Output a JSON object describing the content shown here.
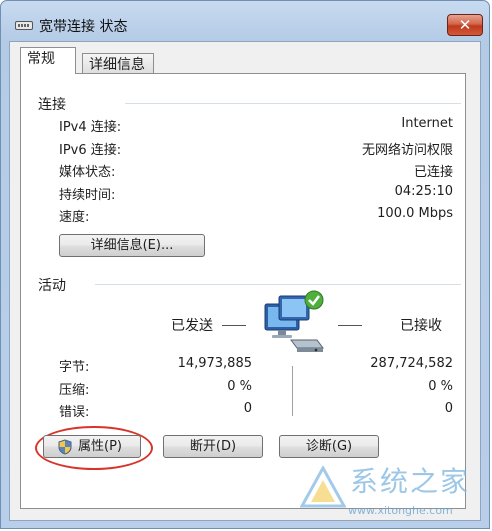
{
  "window": {
    "title": "宽带连接 状态",
    "close_label": "✕"
  },
  "tabs": [
    {
      "label": "常规",
      "active": true
    },
    {
      "label": "详细信息",
      "active": false
    }
  ],
  "connection": {
    "section_label": "连接",
    "rows": [
      {
        "label": "IPv4 连接:",
        "value": "Internet"
      },
      {
        "label": "IPv6 连接:",
        "value": "无网络访问权限"
      },
      {
        "label": "媒体状态:",
        "value": "已连接"
      },
      {
        "label": "持续时间:",
        "value": "04:25:10"
      },
      {
        "label": "速度:",
        "value": "100.0 Mbps"
      }
    ],
    "details_button": "详细信息(E)..."
  },
  "activity": {
    "section_label": "活动",
    "sent_label": "已发送",
    "received_label": "已接收",
    "rows": [
      {
        "label": "字节:",
        "sent": "14,973,885",
        "received": "287,724,582"
      },
      {
        "label": "压缩:",
        "sent": "0 %",
        "received": "0 %"
      },
      {
        "label": "错误:",
        "sent": "0",
        "received": "0"
      }
    ]
  },
  "buttons": {
    "properties": "属性(P)",
    "disconnect": "断开(D)",
    "diagnose": "诊断(G)"
  },
  "watermark": {
    "text": "系统之家",
    "url": "www.xitonghe.com"
  },
  "colors": {
    "title_bar": "#b9cfe9",
    "close_button": "#c8472a",
    "highlight_ring": "#d9342b",
    "watermark": "#7cb5df"
  }
}
